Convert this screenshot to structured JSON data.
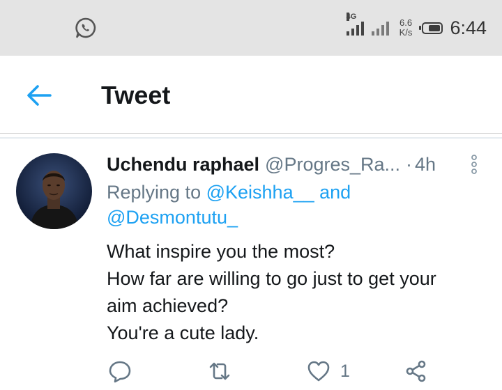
{
  "status_bar": {
    "network_label": "4G",
    "speed_value": "6.6",
    "speed_unit": "K/s",
    "time": "6:44",
    "battery_level": 0.75,
    "icons": [
      "whatsapp-icon",
      "signal-icon",
      "signal-icon",
      "battery-icon"
    ]
  },
  "header": {
    "title": "Tweet",
    "back_icon": "arrow-left-icon"
  },
  "tweet": {
    "author_name": "Uchendu raphael",
    "author_handle": "@Progres_Ra...",
    "separator": "·",
    "time": "4h",
    "replying_prefix": "Replying to",
    "mention_1": "@Keishha__",
    "conjunction": "and",
    "mention_2": "@Desmontutu_",
    "lines": [
      "What inspire you the most?",
      "How far are willing to go just to get your",
      "aim achieved?",
      "You're a cute lady."
    ]
  },
  "actions": {
    "reply_icon": "comment-icon",
    "retweet_icon": "retweet-icon",
    "like_icon": "heart-icon",
    "like_count": "1",
    "share_icon": "share-icon"
  },
  "colors": {
    "accent": "#1da1f2",
    "secondary_text": "#657786",
    "primary_text": "#14171a",
    "status_bar_bg": "#e4e4e4"
  }
}
